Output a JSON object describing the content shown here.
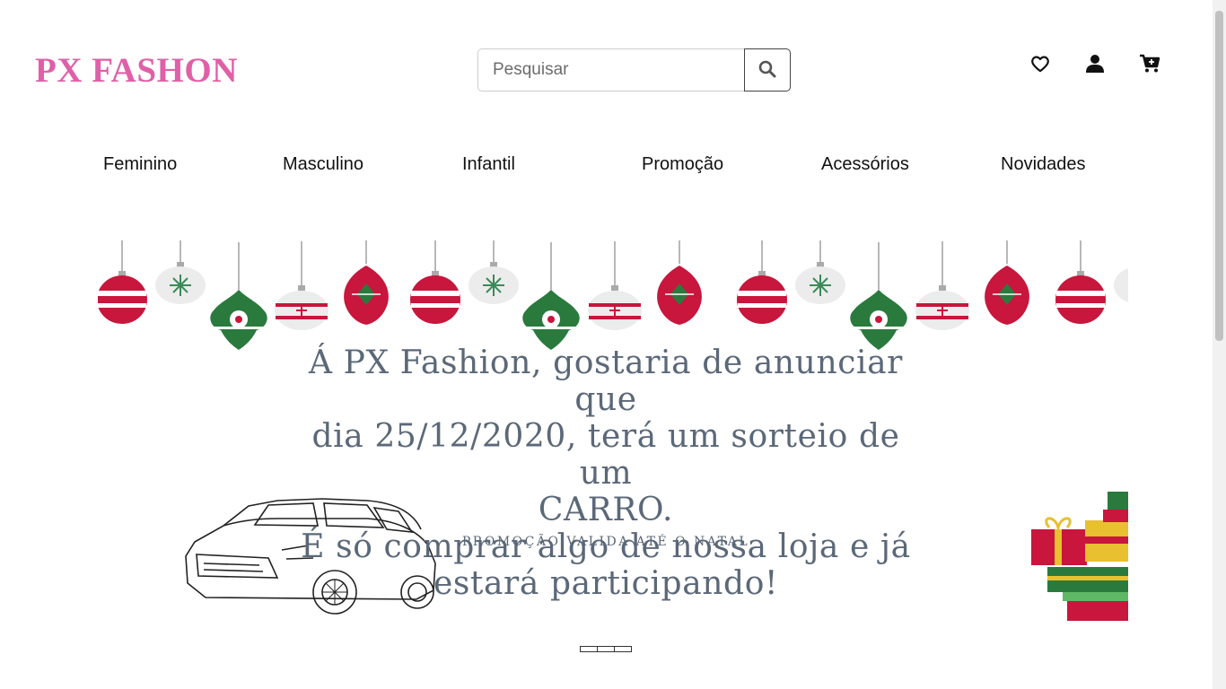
{
  "brand": {
    "logo": "PX FASHON",
    "color": "#e060a8"
  },
  "search": {
    "placeholder": "Pesquisar",
    "value": "",
    "button_icon": "search-icon"
  },
  "header_icons": [
    "heart-icon",
    "user-icon",
    "cart-icon"
  ],
  "nav": {
    "items": [
      {
        "label": "Feminino"
      },
      {
        "label": "Masculino"
      },
      {
        "label": "Infantil"
      },
      {
        "label": "Promoção"
      },
      {
        "label": "Acessórios"
      },
      {
        "label": "Novidades"
      }
    ]
  },
  "banner": {
    "headline": [
      "Á PX Fashion, gostaria de anunciar que",
      "dia 25/12/2020, terá um sorteio de um",
      "CARRO.",
      "É só comprar algo de nossa loja e já",
      "estará participando!"
    ],
    "subline": "PROMOÇÃO VALIDA ATÉ O NATAL",
    "text_color": "#5b6878",
    "ornament_colors": {
      "red": "#c8163c",
      "green": "#2a7a3e",
      "white": "#ececec"
    }
  },
  "carousel": {
    "indicator_count": 3,
    "active_index": 0
  }
}
